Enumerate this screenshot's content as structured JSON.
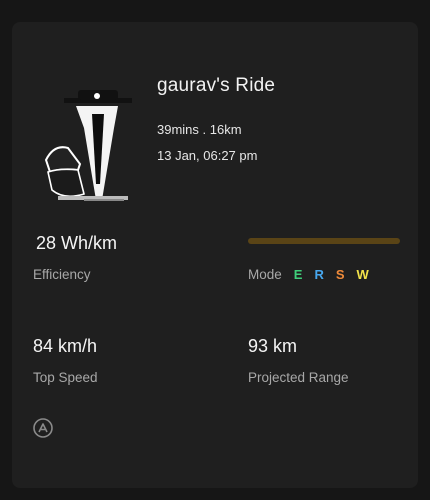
{
  "ride": {
    "title": "gaurav's Ride",
    "summary": "39mins . 16km",
    "datetime": "13 Jan, 06:27 pm"
  },
  "stats": {
    "efficiency_value": "28 Wh/km",
    "efficiency_label": "Efficiency",
    "top_speed_value": "84 km/h",
    "top_speed_label": "Top Speed",
    "range_value": "93 km",
    "range_label": "Projected Range"
  },
  "mode": {
    "label": "Mode",
    "bar_color": "#5a4416",
    "letters": [
      {
        "text": "E",
        "color": "#3fcf7a"
      },
      {
        "text": "R",
        "color": "#47a7ee"
      },
      {
        "text": "S",
        "color": "#ef8a3a"
      },
      {
        "text": "W",
        "color": "#f2e24a"
      }
    ]
  },
  "icons": {
    "thumbnail": "scooter-avatar-icon",
    "brand": "ather-logo-icon"
  }
}
